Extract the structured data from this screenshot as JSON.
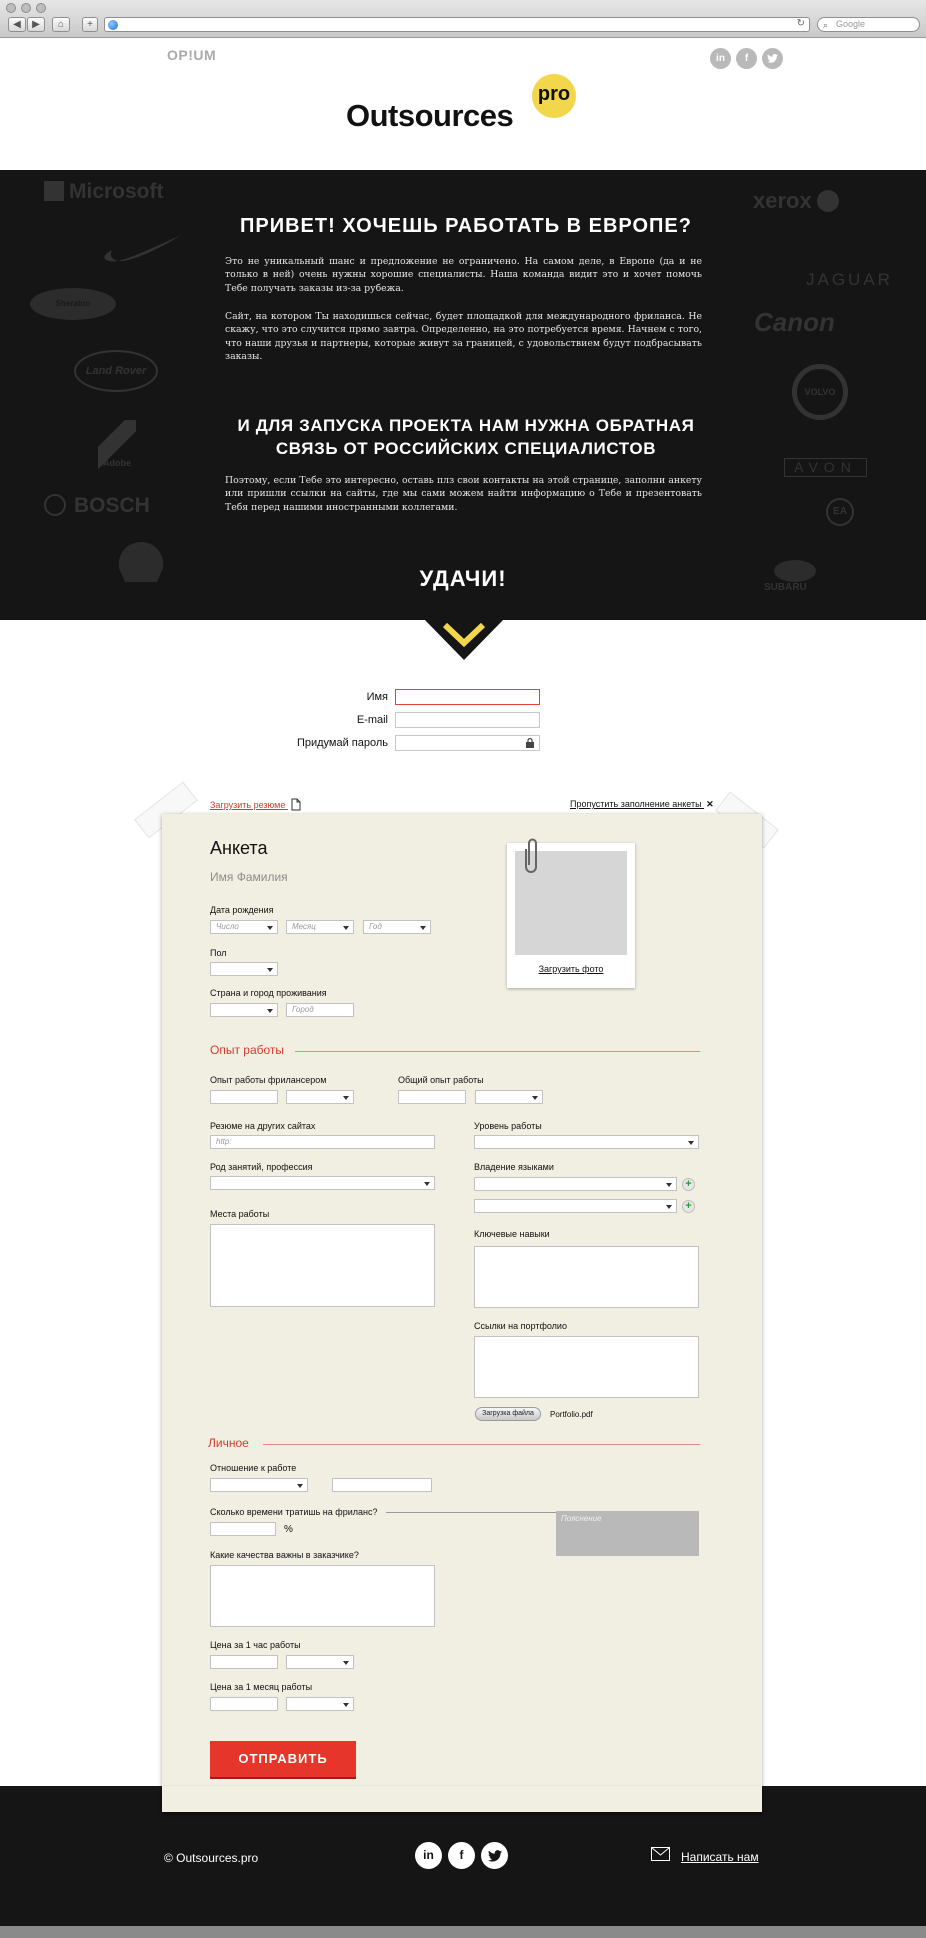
{
  "browser": {
    "back": "◀",
    "forward": "▶",
    "home": "⌂",
    "add": "+",
    "reload": "↻",
    "search_placeholder": "Google"
  },
  "header": {
    "opium": "OP!UM",
    "logo_word": "Outsources",
    "logo_pro": "pro",
    "social": [
      "in",
      "f",
      "t"
    ]
  },
  "hero": {
    "brands_left": [
      "Microsoft",
      "Nike",
      "Sheraton",
      "Land Rover",
      "Adobe",
      "BOSCH",
      "Shell"
    ],
    "brands_right": [
      "xerox",
      "JAGUAR",
      "Canon",
      "VOLVO",
      "AVON",
      "EA",
      "SUBARU"
    ],
    "title": "Привет! Хочешь работать в Европе?",
    "p1": "Это не уникальный шанс и предложение не ограничено. На самом деле, в Европе (да и не только в ней) очень нужны хорошие специалисты. Наша команда видит это и хочет помочь Тебе получать заказы из-за рубежа.",
    "p2": "Сайт, на котором Ты находишься сейчас, будет площадкой для международного фриланса. Не скажу, что это случится прямо завтра. Определенно, на это потребуется время. Начнем с того, что наши друзья и партнеры, которые живут за границей, с удовольствием будут подбрасывать заказы.",
    "subtitle": "И для запуска проекта нам нужна обратная связь от российских специалистов",
    "p3": "Поэтому, если Тебе это интересно, оставь плз свои контакты на этой странице, заполни анкету или пришли ссылки на сайты, где мы сами можем найти информацию о Тебе и презентовать Тебя перед нашими иностранными коллегами.",
    "luck": "Удачи!"
  },
  "registration": {
    "name_label": "Имя",
    "email_label": "E-mail",
    "password_label": "Придумай пароль"
  },
  "form": {
    "upload_resume": "Загрузить резюме",
    "skip": "Пропустить заполнение анкеты",
    "skip_icon": "✕",
    "title": "Анкета",
    "full_name": "Имя Фамилия",
    "upload_photo": "Загрузить фото",
    "birth_label": "Дата рождения",
    "day": "Число",
    "month": "Месяц",
    "year": "Год",
    "gender_label": "Пол",
    "country_label": "Страна и город проживания",
    "city": "Город",
    "experience_section": "Опыт работы",
    "freelance_exp_label": "Опыт работы фрилансером",
    "total_exp_label": "Общий опыт работы",
    "resume_other_label": "Резюме на других сайтах",
    "resume_other_placeholder": "http:",
    "work_level_label": "Уровень работы",
    "occupation_label": "Род занятий, профессия",
    "languages_label": "Владение языками",
    "workplaces_label": "Места работы",
    "skills_label": "Ключевые навыки",
    "portfolio_label": "Ссылки на портфолио",
    "upload_file": "Загрузка файла",
    "file_name": "Portfolio.pdf",
    "personal_section": "Личное",
    "attitude_label": "Отношение к работе",
    "time_label": "Сколько времени тратишь на фриланс?",
    "percent": "%",
    "note": "Пояснение",
    "qualities_label": "Какие качества важны в заказчике?",
    "hourly_label": "Цена за 1 час работы",
    "monthly_label": "Цена за 1 месяц работы",
    "submit": "Отправить"
  },
  "footer": {
    "copyright": "© Outsources.pro",
    "social": [
      "in",
      "f",
      "t"
    ],
    "write_us": "Написать нам"
  }
}
